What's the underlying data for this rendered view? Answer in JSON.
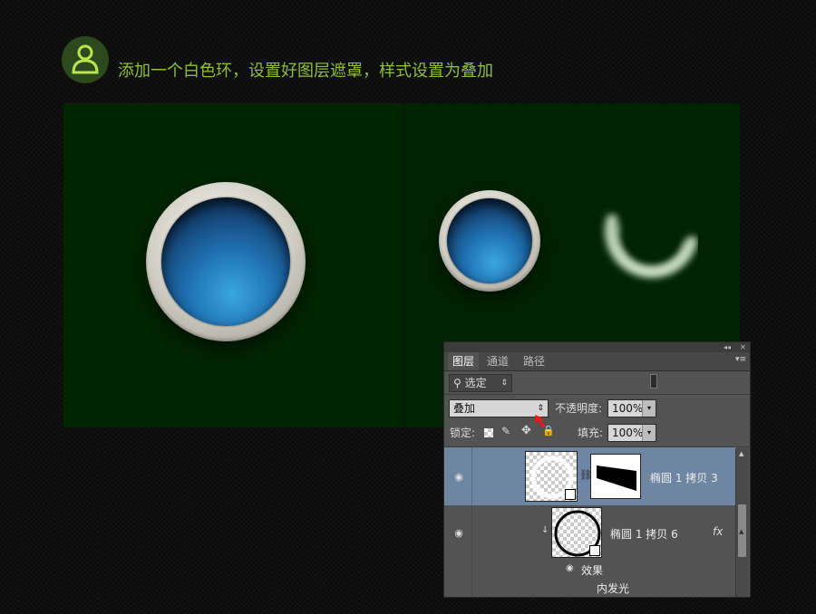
{
  "step": {
    "title": "添加一个白色环，设置好图层遮罩，样式设置为叠加"
  },
  "layers_panel": {
    "topbar": {
      "collapse": "◂◂",
      "close": "✕"
    },
    "tabs": [
      {
        "label": "图层",
        "active": true
      },
      {
        "label": "通道",
        "active": false
      },
      {
        "label": "路径",
        "active": false
      }
    ],
    "filter": {
      "value": "选定"
    },
    "blend_mode": "叠加",
    "opacity_label": "不透明度:",
    "opacity_value": "100%",
    "lock_label": "锁定:",
    "fill_label": "填充:",
    "fill_value": "100%",
    "layers": [
      {
        "name": "椭圆 1 拷贝 3",
        "selected": true,
        "has_mask": true
      },
      {
        "name": "椭圆 1 拷贝 6",
        "selected": false,
        "fx": "fx",
        "effects_label": "效果",
        "effects": [
          "内发光"
        ]
      }
    ]
  },
  "colors": {
    "canvas_bg": "#012301",
    "title_green": "#8fbe3a",
    "selection_blue": "#6f86a3"
  },
  "icons": [
    "step-person-icon",
    "search-icon",
    "eye-icon",
    "link-icon",
    "lock-transparent-icon",
    "brush-icon",
    "move-icon",
    "lock-icon",
    "fx-icon",
    "red-arrow-icon"
  ]
}
